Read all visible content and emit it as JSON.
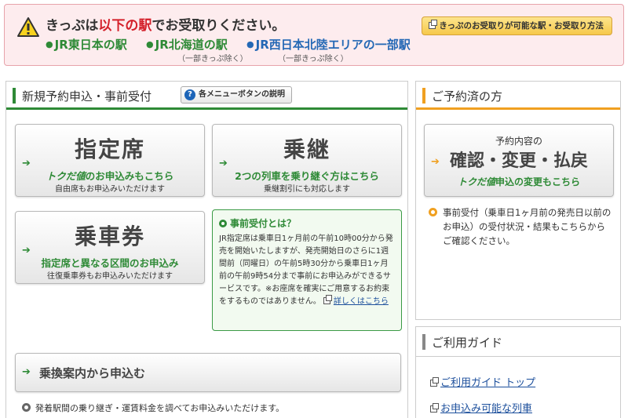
{
  "notice": {
    "title_pre": "きっぷは",
    "title_red": "以下の駅",
    "title_post": "でお受取りください。",
    "stations": [
      {
        "name": "JR東日本の駅",
        "note": ""
      },
      {
        "name": "JR北海道の駅",
        "note": "（一部きっぷ除く）"
      },
      {
        "name": "JR西日本北陸エリアの一部駅",
        "note": "（一部きっぷ除く）"
      }
    ],
    "guide_button": "きっぷのお受取りが可能な駅・お受取り方法"
  },
  "new_reservation": {
    "title": "新規予約申込・事前受付",
    "help_button": "各メニューボタンの説明",
    "reserved_seat": {
      "label": "指定席",
      "sub_doku": "トクだ値",
      "sub_rest": "のお申込みもこちら",
      "note": "自由席もお申込みいただけます"
    },
    "transfer": {
      "label": "乗継",
      "sub": "2つの列車を乗り継ぐ方はこちら",
      "note": "乗継割引にも対応します"
    },
    "ticket": {
      "label": "乗車券",
      "sub": "指定席と異なる区間のお申込み",
      "note": "往復乗車券もお申込みいただけます"
    },
    "advance": {
      "title": "事前受付とは？",
      "text": "JR指定席は乗車日1ヶ月前の午前10時00分から発売を開始いたしますが、発売開始日のさらに1週間前（同曜日）の午前5時30分から乗車日1ヶ月前の午前9時54分まで事前にお申込みができるサービスです。※お座席を確実にご用意するお約束をするものではありません。",
      "link": "詳しくはこちら"
    },
    "route": {
      "label": "乗換案内から申込む",
      "note": "発着駅間の乗り継ぎ・運賃料金を調べてお申込みいただけます。"
    }
  },
  "existing": {
    "title": "ご予約済の方",
    "button_top": "予約内容の",
    "button_main": "確認・変更・払戻",
    "button_sub_doku": "トクだ値",
    "button_sub_rest": "申込の変更もこちら",
    "note": "事前受付（乗車日1ヶ月前の発売日以前のお申込）の受付状況・結果もこちらからご確認ください。"
  },
  "guide": {
    "title": "ご利用ガイド",
    "links": [
      "ご利用ガイド トップ",
      "お申込み可能な列車"
    ]
  },
  "colors": {
    "green": "#2e8a36",
    "orange": "#f0a020",
    "red": "#d4212b",
    "blue": "#1c4f9c"
  }
}
